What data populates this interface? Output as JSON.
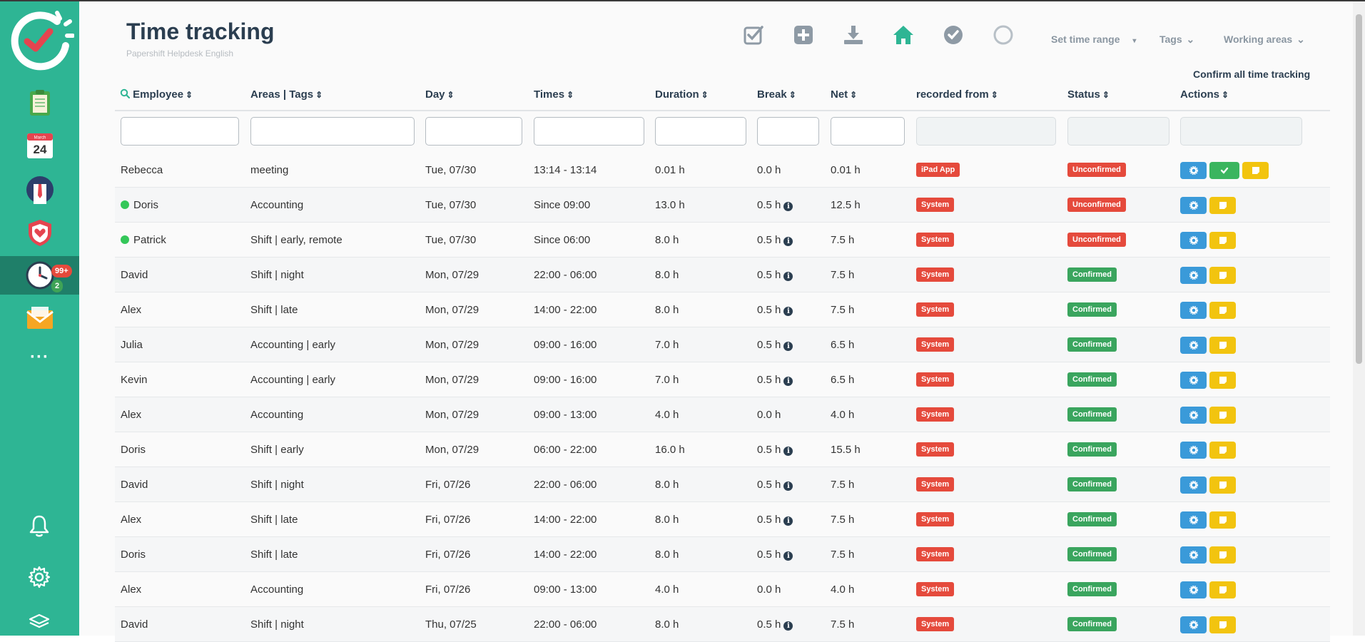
{
  "header": {
    "title": "Time tracking",
    "subtitle": "Papershift Helpdesk English",
    "filters": {
      "time_range": "Set time range",
      "tags": "Tags",
      "working_areas": "Working areas"
    },
    "confirm_all": "Confirm all time tracking"
  },
  "sidebar": {
    "calendar_month": "March",
    "calendar_day": "24",
    "badge_red": "99+",
    "badge_green": "2",
    "more": "···"
  },
  "columns": [
    "Employee",
    "Areas | Tags",
    "Day",
    "Times",
    "Duration",
    "Break",
    "Net",
    "recorded from",
    "Status",
    "Actions"
  ],
  "rows": [
    {
      "employee": "Rebecca",
      "online": false,
      "area": "meeting",
      "day": "Tue, 07/30",
      "times": "13:14 - 13:14",
      "duration": "0.01 h",
      "break": "0.0 h",
      "break_info": false,
      "net": "0.01 h",
      "source": "iPad App",
      "status": "Unconfirmed",
      "can_confirm": true
    },
    {
      "employee": "Doris",
      "online": true,
      "area": "Accounting",
      "day": "Tue, 07/30",
      "times": "Since 09:00",
      "duration": "13.0 h",
      "break": "0.5 h",
      "break_info": true,
      "net": "12.5 h",
      "source": "System",
      "status": "Unconfirmed",
      "can_confirm": false
    },
    {
      "employee": "Patrick",
      "online": true,
      "area": "Shift | early, remote",
      "day": "Tue, 07/30",
      "times": "Since 06:00",
      "duration": "8.0 h",
      "break": "0.5 h",
      "break_info": true,
      "net": "7.5 h",
      "source": "System",
      "status": "Unconfirmed",
      "can_confirm": false
    },
    {
      "employee": "David",
      "online": false,
      "area": "Shift | night",
      "day": "Mon, 07/29",
      "times": "22:00 - 06:00",
      "duration": "8.0 h",
      "break": "0.5 h",
      "break_info": true,
      "net": "7.5 h",
      "source": "System",
      "status": "Confirmed",
      "can_confirm": false
    },
    {
      "employee": "Alex",
      "online": false,
      "area": "Shift | late",
      "day": "Mon, 07/29",
      "times": "14:00 - 22:00",
      "duration": "8.0 h",
      "break": "0.5 h",
      "break_info": true,
      "net": "7.5 h",
      "source": "System",
      "status": "Confirmed",
      "can_confirm": false
    },
    {
      "employee": "Julia",
      "online": false,
      "area": "Accounting | early",
      "day": "Mon, 07/29",
      "times": "09:00 - 16:00",
      "duration": "7.0 h",
      "break": "0.5 h",
      "break_info": true,
      "net": "6.5 h",
      "source": "System",
      "status": "Confirmed",
      "can_confirm": false
    },
    {
      "employee": "Kevin",
      "online": false,
      "area": "Accounting | early",
      "day": "Mon, 07/29",
      "times": "09:00 - 16:00",
      "duration": "7.0 h",
      "break": "0.5 h",
      "break_info": true,
      "net": "6.5 h",
      "source": "System",
      "status": "Confirmed",
      "can_confirm": false
    },
    {
      "employee": "Alex",
      "online": false,
      "area": "Accounting",
      "day": "Mon, 07/29",
      "times": "09:00 - 13:00",
      "duration": "4.0 h",
      "break": "0.0 h",
      "break_info": false,
      "net": "4.0 h",
      "source": "System",
      "status": "Confirmed",
      "can_confirm": false
    },
    {
      "employee": "Doris",
      "online": false,
      "area": "Shift | early",
      "day": "Mon, 07/29",
      "times": "06:00 - 22:00",
      "duration": "16.0 h",
      "break": "0.5 h",
      "break_info": true,
      "net": "15.5 h",
      "source": "System",
      "status": "Confirmed",
      "can_confirm": false
    },
    {
      "employee": "David",
      "online": false,
      "area": "Shift | night",
      "day": "Fri, 07/26",
      "times": "22:00 - 06:00",
      "duration": "8.0 h",
      "break": "0.5 h",
      "break_info": true,
      "net": "7.5 h",
      "source": "System",
      "status": "Confirmed",
      "can_confirm": false
    },
    {
      "employee": "Alex",
      "online": false,
      "area": "Shift | late",
      "day": "Fri, 07/26",
      "times": "14:00 - 22:00",
      "duration": "8.0 h",
      "break": "0.5 h",
      "break_info": true,
      "net": "7.5 h",
      "source": "System",
      "status": "Confirmed",
      "can_confirm": false
    },
    {
      "employee": "Doris",
      "online": false,
      "area": "Shift | late",
      "day": "Fri, 07/26",
      "times": "14:00 - 22:00",
      "duration": "8.0 h",
      "break": "0.5 h",
      "break_info": true,
      "net": "7.5 h",
      "source": "System",
      "status": "Confirmed",
      "can_confirm": false
    },
    {
      "employee": "Alex",
      "online": false,
      "area": "Accounting",
      "day": "Fri, 07/26",
      "times": "09:00 - 13:00",
      "duration": "4.0 h",
      "break": "0.0 h",
      "break_info": false,
      "net": "4.0 h",
      "source": "System",
      "status": "Confirmed",
      "can_confirm": false
    },
    {
      "employee": "David",
      "online": false,
      "area": "Shift | night",
      "day": "Thu, 07/25",
      "times": "22:00 - 06:00",
      "duration": "8.0 h",
      "break": "0.5 h",
      "break_info": true,
      "net": "7.5 h",
      "source": "System",
      "status": "Confirmed",
      "can_confirm": false
    }
  ],
  "colors": {
    "sidebar": "#2eb594",
    "sidebar_active": "#1f7f69",
    "title": "#2b3e50",
    "danger": "#e54a3c",
    "success": "#3aa55e",
    "primary": "#3a9ad9",
    "warning": "#f2c40f"
  },
  "icons": {
    "toolbar": [
      "checkbox-icon",
      "plus-square-icon",
      "download-icon",
      "home-icon",
      "check-circle-icon",
      "circle-outline-icon"
    ]
  }
}
